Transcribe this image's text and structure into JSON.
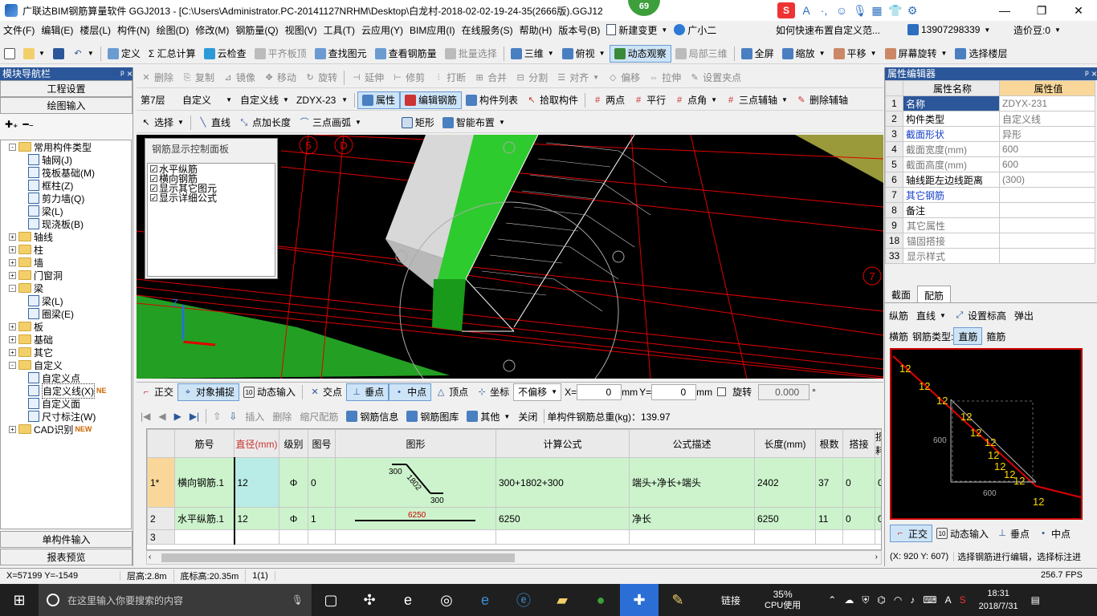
{
  "window": {
    "title": "广联达BIM钢筋算量软件 GGJ2013 - [C:\\Users\\Administrator.PC-20141127NRHM\\Desktop\\白龙村-2018-02-02-19-24-35(2666版).GGJ12",
    "badge": "69",
    "min": "—",
    "max": "❐",
    "close": "✕"
  },
  "ime": {
    "logo": "S",
    "icons": [
      "A",
      "·,",
      "☺",
      "🎙",
      "▦",
      "👕",
      "⚙"
    ]
  },
  "menu": {
    "items": [
      "文件(F)",
      "编辑(E)",
      "楼层(L)",
      "构件(N)",
      "绘图(D)",
      "修改(M)",
      "钢筋量(Q)",
      "视图(V)",
      "工具(T)",
      "云应用(Y)",
      "BIM应用(I)",
      "在线服务(S)",
      "帮助(H)",
      "版本号(B)"
    ],
    "new_change": "新建变更",
    "guangxiaoer": "广小二",
    "help_link": "如何快速布置自定义范...",
    "phone": "13907298339",
    "price_bean": "造价豆:0"
  },
  "toolbar1": {
    "items": [
      "定义",
      "Σ 汇总计算",
      "云检查",
      "平齐板顶",
      "查找图元",
      "查看钢筋量",
      "批量选择",
      "三维",
      "俯视",
      "动态观察",
      "局部三维",
      "全屏",
      "缩放",
      "平移",
      "屏幕旋转",
      "选择楼层"
    ]
  },
  "toolbar2": {
    "items": [
      "删除",
      "复制",
      "镜像",
      "移动",
      "旋转",
      "延伸",
      "修剪",
      "打断",
      "合并",
      "分割",
      "对齐",
      "偏移",
      "拉伸",
      "设置夹点"
    ]
  },
  "toolbar3": {
    "floor": "第7层",
    "type": "自定义",
    "subtype": "自定义线",
    "code": "ZDYX-23",
    "items": [
      "属性",
      "编辑钢筋",
      "构件列表",
      "拾取构件",
      "两点",
      "平行",
      "点角",
      "三点辅轴",
      "删除辅轴"
    ]
  },
  "toolbar4": {
    "items": [
      "选择",
      "直线",
      "点加长度",
      "三点画弧",
      "矩形",
      "智能布置"
    ]
  },
  "left": {
    "header": "模块导航栏",
    "pin": "ᵖ ×",
    "btn_project": "工程设置",
    "btn_draw": "绘图输入",
    "tree": [
      {
        "label": "常用构件类型",
        "level": 0,
        "kind": "folder",
        "exp": "-"
      },
      {
        "label": "轴网(J)",
        "level": 1,
        "kind": "leaf"
      },
      {
        "label": "筏板基础(M)",
        "level": 1,
        "kind": "leaf"
      },
      {
        "label": "框柱(Z)",
        "level": 1,
        "kind": "leaf"
      },
      {
        "label": "剪力墙(Q)",
        "level": 1,
        "kind": "leaf"
      },
      {
        "label": "梁(L)",
        "level": 1,
        "kind": "leaf"
      },
      {
        "label": "现浇板(B)",
        "level": 1,
        "kind": "leaf"
      },
      {
        "label": "轴线",
        "level": 0,
        "kind": "folder",
        "exp": "+"
      },
      {
        "label": "柱",
        "level": 0,
        "kind": "folder",
        "exp": "+"
      },
      {
        "label": "墙",
        "level": 0,
        "kind": "folder",
        "exp": "+"
      },
      {
        "label": "门窗洞",
        "level": 0,
        "kind": "folder",
        "exp": "+"
      },
      {
        "label": "梁",
        "level": 0,
        "kind": "folder",
        "exp": "-"
      },
      {
        "label": "梁(L)",
        "level": 1,
        "kind": "leaf"
      },
      {
        "label": "圈梁(E)",
        "level": 1,
        "kind": "leaf"
      },
      {
        "label": "板",
        "level": 0,
        "kind": "folder",
        "exp": "+"
      },
      {
        "label": "基础",
        "level": 0,
        "kind": "folder",
        "exp": "+"
      },
      {
        "label": "其它",
        "level": 0,
        "kind": "folder",
        "exp": "+"
      },
      {
        "label": "自定义",
        "level": 0,
        "kind": "folder",
        "exp": "-"
      },
      {
        "label": "自定义点",
        "level": 1,
        "kind": "leaf"
      },
      {
        "label": "自定义线(X)",
        "level": 1,
        "kind": "leaf",
        "tag": "NE"
      },
      {
        "label": "自定义面",
        "level": 1,
        "kind": "leaf"
      },
      {
        "label": "尺寸标注(W)",
        "level": 1,
        "kind": "leaf"
      },
      {
        "label": "CAD识别",
        "level": 0,
        "kind": "folder",
        "exp": "+",
        "tag": "NEW"
      }
    ],
    "btn_single": "单构件输入",
    "btn_report": "报表预览"
  },
  "viewport": {
    "axis_labels": [
      "5",
      "D",
      "7"
    ],
    "panel_title": "钢筋显示控制面板",
    "checks": [
      "水平纵筋",
      "横向钢筋",
      "显示其它图元",
      "显示详细公式"
    ]
  },
  "snap": {
    "items": [
      "正交",
      "对象捕捉",
      "动态输入",
      "交点",
      "垂点",
      "中点",
      "顶点",
      "坐标"
    ],
    "offset_mode": "不偏移",
    "x_label": "X=",
    "x_val": "0",
    "y_label": "Y=",
    "y_val": "0",
    "unit": "mm",
    "rotate": "旋转",
    "rotate_val": "0.000",
    "deg": "°"
  },
  "rebar_toolbar": {
    "items": [
      "插入",
      "删除",
      "缩尺配筋",
      "钢筋信息",
      "钢筋图库",
      "其他",
      "关闭"
    ],
    "total": "单构件钢筋总重(kg)：139.97"
  },
  "grid": {
    "headers": [
      "",
      "筋号",
      "直径(mm)",
      "级别",
      "图号",
      "图形",
      "计算公式",
      "公式描述",
      "长度(mm)",
      "根数",
      "搭接",
      "损耗"
    ],
    "rows": [
      {
        "no": "1*",
        "name": "横向钢筋.1",
        "dia": "12",
        "grade": "Φ",
        "fig": "0",
        "shape_a": "300",
        "shape_b": "1802",
        "shape_c": "300",
        "formula": "300+1802+300",
        "desc": "端头+净长+端头",
        "len": "2402",
        "count": "37",
        "lap": "0",
        "loss": "0"
      },
      {
        "no": "2",
        "name": "水平纵筋.1",
        "dia": "12",
        "grade": "Φ",
        "fig": "1",
        "shape_a": "6250",
        "shape_b": "",
        "shape_c": "",
        "formula": "6250",
        "desc": "净长",
        "len": "6250",
        "count": "11",
        "lap": "0",
        "loss": "0"
      },
      {
        "no": "3",
        "name": "",
        "dia": "",
        "grade": "",
        "fig": "",
        "shape_a": "",
        "shape_b": "",
        "shape_c": "",
        "formula": "",
        "desc": "",
        "len": "",
        "count": "",
        "lap": "",
        "loss": ""
      }
    ]
  },
  "props": {
    "header": "属性编辑器",
    "col_name": "属性名称",
    "col_val": "属性值",
    "rows": [
      {
        "no": "1",
        "name": "名称",
        "val": "ZDYX-231",
        "name_cls": "blue",
        "val_cls": "gray"
      },
      {
        "no": "2",
        "name": "构件类型",
        "val": "自定义线",
        "name_cls": "",
        "val_cls": "gray"
      },
      {
        "no": "3",
        "name": "截面形状",
        "val": "异形",
        "name_cls": "blue",
        "val_cls": "gray"
      },
      {
        "no": "4",
        "name": "截面宽度(mm)",
        "val": "600",
        "name_cls": "gray",
        "val_cls": "gray"
      },
      {
        "no": "5",
        "name": "截面高度(mm)",
        "val": "600",
        "name_cls": "gray",
        "val_cls": "gray"
      },
      {
        "no": "6",
        "name": "轴线距左边线距离",
        "val": "(300)",
        "name_cls": "",
        "val_cls": "gray"
      },
      {
        "no": "7",
        "name": "其它钢筋",
        "val": "",
        "name_cls": "blue",
        "val_cls": ""
      },
      {
        "no": "8",
        "name": "备注",
        "val": "",
        "name_cls": "",
        "val_cls": ""
      },
      {
        "no": "9",
        "name": "其它属性",
        "val": "",
        "name_cls": "gray",
        "val_cls": ""
      },
      {
        "no": "18",
        "name": "锚固搭接",
        "val": "",
        "name_cls": "gray",
        "val_cls": ""
      },
      {
        "no": "33",
        "name": "显示样式",
        "val": "",
        "name_cls": "gray",
        "val_cls": ""
      }
    ],
    "tab_section": "截面",
    "tab_rebar": "配筋",
    "rebar_tools": [
      "纵筋",
      "直线",
      "设置标高",
      "弹出"
    ],
    "rebar_type_row": [
      "横筋",
      "钢筋类型:",
      "直筋",
      "箍筋"
    ],
    "section_labels": [
      "12",
      "12",
      "12",
      "12",
      "12",
      "12",
      "12",
      "12",
      "12",
      "12",
      "12",
      "600",
      "600"
    ],
    "bottom_tools": [
      "正交",
      "动态输入",
      "垂点",
      "中点"
    ],
    "coords": "(X: 920 Y: 607)",
    "hint": "选择钢筋进行编辑，选择标注进"
  },
  "status": {
    "xy": "X=57199 Y=-1549",
    "floor_h": "层高:2.8m",
    "bottom_h": "底标高:20.35m",
    "count": "1(1)",
    "fps": "256.7 FPS"
  },
  "taskbar": {
    "search": "在这里输入你要搜索的内容",
    "link": "链接",
    "cpu": "35%",
    "cpu_label": "CPU使用",
    "time": "18:31",
    "date": "2018/7/31",
    "lang": "A"
  }
}
